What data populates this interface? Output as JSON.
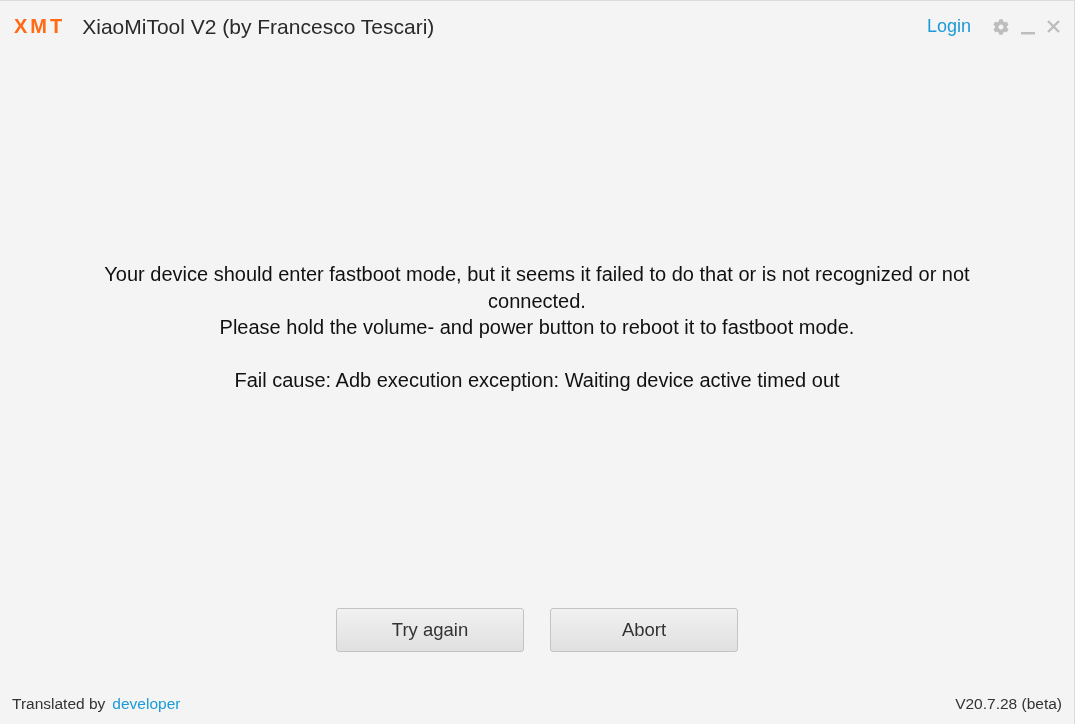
{
  "title_bar": {
    "logo": "XMT",
    "title": "XiaoMiTool V2 (by Francesco Tescari)",
    "login_link": "Login"
  },
  "message": {
    "paragraphs": [
      "Your device should enter fastboot mode, but it seems it failed to do that or is not recognized or not connected.",
      "Please hold the volume- and power button to reboot it to fastboot mode."
    ],
    "fail_cause": "Fail cause: Adb execution exception: Waiting device active timed out"
  },
  "buttons": [
    "Try again",
    "Abort"
  ],
  "footer": {
    "translated_by_label": "Translated by",
    "translator_link": "developer",
    "version": "V20.7.28 (beta)"
  }
}
